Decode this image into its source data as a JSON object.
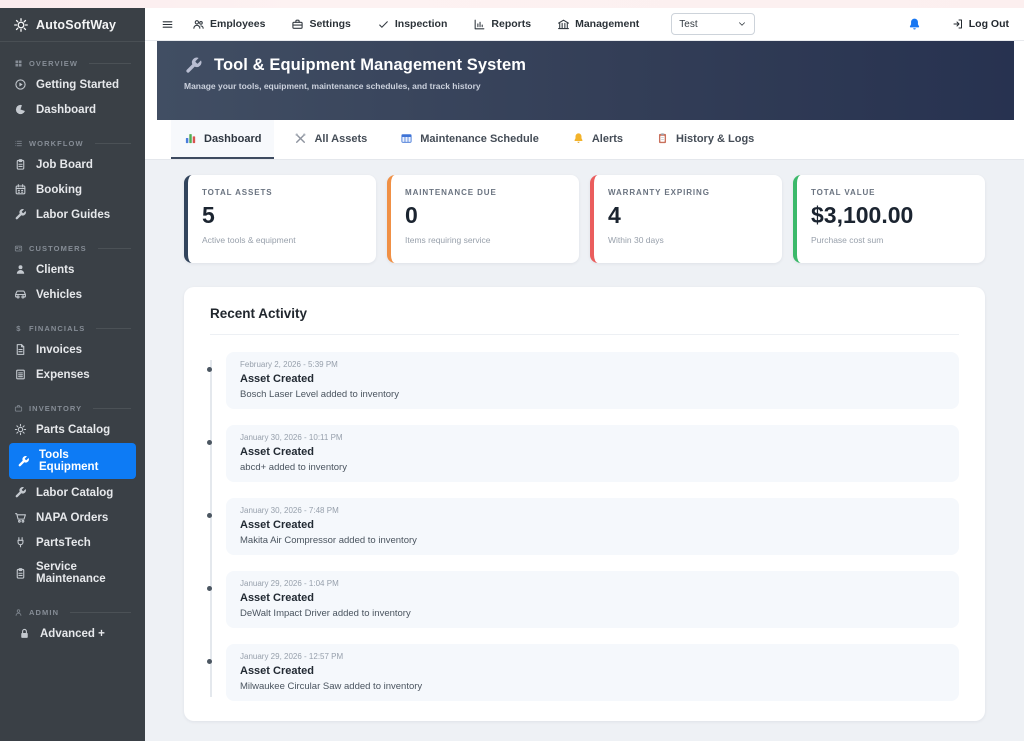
{
  "brand": {
    "name": "AutoSoftWay"
  },
  "topnav": {
    "employees": "Employees",
    "settings": "Settings",
    "inspection": "Inspection",
    "reports": "Reports",
    "management": "Management",
    "workspace_selected": "Test",
    "logout": "Log Out"
  },
  "sidebar": {
    "sections": [
      {
        "label": "OVERVIEW",
        "items": [
          {
            "label": "Getting Started"
          },
          {
            "label": "Dashboard"
          }
        ]
      },
      {
        "label": "WORKFLOW",
        "items": [
          {
            "label": "Job Board"
          },
          {
            "label": "Booking"
          },
          {
            "label": "Labor Guides"
          }
        ]
      },
      {
        "label": "CUSTOMERS",
        "items": [
          {
            "label": "Clients"
          },
          {
            "label": "Vehicles"
          }
        ]
      },
      {
        "label": "FINANCIALS",
        "items": [
          {
            "label": "Invoices"
          },
          {
            "label": "Expenses"
          }
        ]
      },
      {
        "label": "INVENTORY",
        "items": [
          {
            "label": "Parts Catalog"
          },
          {
            "label": "Tools Equipment",
            "active": true
          },
          {
            "label": "Labor Catalog"
          },
          {
            "label": "NAPA Orders"
          },
          {
            "label": "PartsTech"
          },
          {
            "label": "Service Maintenance"
          }
        ]
      },
      {
        "label": "ADMIN",
        "items": [
          {
            "label": "Advanced +"
          }
        ]
      }
    ],
    "active_item": "Tools Equipment",
    "active_color": "#0d7bf5"
  },
  "hero": {
    "title": "Tool & Equipment Management System",
    "subtitle": "Manage your tools, equipment, maintenance schedules, and track history"
  },
  "tabs": [
    {
      "label": "Dashboard",
      "active": true
    },
    {
      "label": "All Assets"
    },
    {
      "label": "Maintenance Schedule"
    },
    {
      "label": "Alerts"
    },
    {
      "label": "History & Logs"
    }
  ],
  "stats": [
    {
      "label": "TOTAL ASSETS",
      "value": "5",
      "sub": "Active tools & equipment",
      "accent": "#32445c"
    },
    {
      "label": "MAINTENANCE DUE",
      "value": "0",
      "sub": "Items requiring service",
      "accent": "#f09045"
    },
    {
      "label": "WARRANTY EXPIRING",
      "value": "4",
      "sub": "Within 30 days",
      "accent": "#ea5d5d"
    },
    {
      "label": "TOTAL VALUE",
      "value": "$3,100.00",
      "sub": "Purchase cost sum",
      "accent": "#3cb96a"
    }
  ],
  "activity": {
    "title": "Recent Activity",
    "entries": [
      {
        "timestamp": "February 2, 2026 - 5:39 PM",
        "title": "Asset Created",
        "description": "Bosch Laser Level added to inventory"
      },
      {
        "timestamp": "January 30, 2026 - 10:11 PM",
        "title": "Asset Created",
        "description": "abcd+ added to inventory"
      },
      {
        "timestamp": "January 30, 2026 - 7:48 PM",
        "title": "Asset Created",
        "description": "Makita Air Compressor added to inventory"
      },
      {
        "timestamp": "January 29, 2026 - 1:04 PM",
        "title": "Asset Created",
        "description": "DeWalt Impact Driver added to inventory"
      },
      {
        "timestamp": "January 29, 2026 - 12:57 PM",
        "title": "Asset Created",
        "description": "Milwaukee Circular Saw added to inventory"
      }
    ]
  }
}
